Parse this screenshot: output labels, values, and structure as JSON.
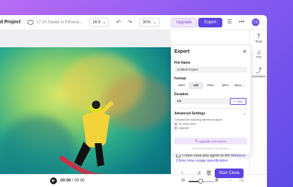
{
  "topbar": {
    "project_title": "d Project",
    "saved_status": "17:10 Saved in Filmora...",
    "aspect_ratio": "16:9",
    "zoom": "30%",
    "upgrade_label": "Upgrade",
    "export_label": "Export",
    "avatar_initial": "CS"
  },
  "export_panel": {
    "title": "Export",
    "file_name_label": "File Name",
    "file_name_value": "Untitled Project",
    "format_label": "Format",
    "formats": [
      "MP4",
      "GIF",
      "PNG",
      "MP3",
      "More"
    ],
    "selected_format": "GIF",
    "duration_label": "Duration",
    "duration_value": "8/8",
    "trim_label": "Trim",
    "advanced_label": "Advanced Settings",
    "advanced_desc": "Contains the following watermark rights",
    "item1": "No video mark",
    "item2": "Upgrade",
    "upgrade_export_label": "Upgrade And Export",
    "note": "Files will be saved in FilmoraCloud."
  },
  "sidebar": [
    {
      "label": "Texts",
      "icon": "text-icon"
    },
    {
      "label": "TTS",
      "icon": "tts-icon"
    },
    {
      "label": "Animation",
      "icon": "animation-icon"
    }
  ],
  "clone": {
    "terms_text": "I have read and agree to the ",
    "terms_link1": "Media.io Clone tone usage specification",
    "start_clone_label": "Start Clone"
  },
  "playbar": {
    "current_time": "00:00",
    "total_time": "00:00"
  },
  "colors": {
    "accent": "#5d43e0",
    "upgrade_bg": "#efe6fd"
  }
}
